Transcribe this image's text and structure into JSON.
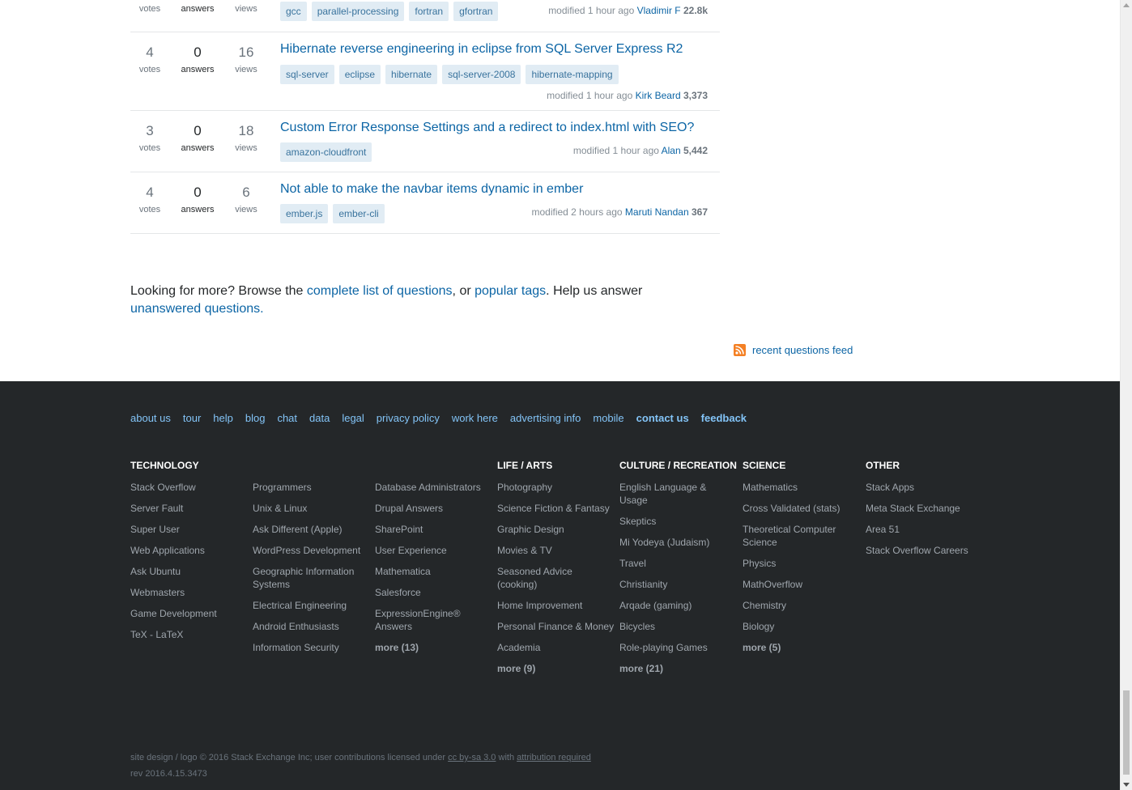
{
  "questions": [
    {
      "votes": "",
      "votes_label": "votes",
      "answers": "",
      "answers_label": "answers",
      "views": "",
      "views_label": "views",
      "title": "",
      "tags": [
        "gcc",
        "parallel-processing",
        "fortran",
        "gfortran"
      ],
      "modified": "modified 1 hour ago",
      "user": "Vladimir F",
      "rep": "22.8k"
    },
    {
      "votes": "4",
      "votes_label": "votes",
      "answers": "0",
      "answers_label": "answers",
      "views": "16",
      "views_label": "views",
      "title": "Hibernate reverse engineering in eclipse from SQL Server Express R2",
      "tags": [
        "sql-server",
        "eclipse",
        "hibernate",
        "sql-server-2008",
        "hibernate-mapping"
      ],
      "modified": "modified 1 hour ago",
      "user": "Kirk Beard",
      "rep": "3,373"
    },
    {
      "votes": "3",
      "votes_label": "votes",
      "answers": "0",
      "answers_label": "answers",
      "views": "18",
      "views_label": "views",
      "title": "Custom Error Response Settings and a redirect to index.html with SEO?",
      "tags": [
        "amazon-cloudfront"
      ],
      "modified": "modified 1 hour ago",
      "user": "Alan",
      "rep": "5,442"
    },
    {
      "votes": "4",
      "votes_label": "votes",
      "answers": "0",
      "answers_label": "answers",
      "views": "6",
      "views_label": "views",
      "title": "Not able to make the navbar items dynamic in ember",
      "tags": [
        "ember.js",
        "ember-cli"
      ],
      "modified": "modified 2 hours ago",
      "user": "Maruti Nandan",
      "rep": "367"
    }
  ],
  "looking_for_more": {
    "prefix": "Looking for more? Browse the ",
    "link1": "complete list of questions",
    "mid": ", or ",
    "link2": "popular tags",
    "suffix": ". Help us answer ",
    "link3": "unanswered questions",
    "end": "."
  },
  "feed": {
    "label": "recent questions feed",
    "icon": "rss-icon"
  },
  "footer": {
    "nav": [
      "about us",
      "tour",
      "help",
      "blog",
      "chat",
      "data",
      "legal",
      "privacy policy",
      "work here",
      "advertising info",
      "mobile",
      "contact us",
      "feedback"
    ],
    "columns": [
      {
        "heading": "TECHNOLOGY",
        "items": [
          "Stack Overflow",
          "Server Fault",
          "Super User",
          "Web Applications",
          "Ask Ubuntu",
          "Webmasters",
          "Game Development",
          "TeX - LaTeX"
        ]
      },
      {
        "heading": "",
        "items": [
          "Programmers",
          "Unix & Linux",
          "Ask Different (Apple)",
          "WordPress Development",
          "Geographic Information Systems",
          "Electrical Engineering",
          "Android Enthusiasts",
          "Information Security"
        ]
      },
      {
        "heading": "",
        "items": [
          "Database Administrators",
          "Drupal Answers",
          "SharePoint",
          "User Experience",
          "Mathematica",
          "Salesforce",
          "ExpressionEngine® Answers",
          "more (13)"
        ]
      },
      {
        "heading": "LIFE / ARTS",
        "items": [
          "Photography",
          "Science Fiction & Fantasy",
          "Graphic Design",
          "Movies & TV",
          "Seasoned Advice (cooking)",
          "Home Improvement",
          "Personal Finance & Money",
          "Academia",
          "more (9)"
        ]
      },
      {
        "heading": "CULTURE / RECREATION",
        "items": [
          "English Language & Usage",
          "Skeptics",
          "Mi Yodeya (Judaism)",
          "Travel",
          "Christianity",
          "Arqade (gaming)",
          "Bicycles",
          "Role-playing Games",
          "more (21)"
        ]
      },
      {
        "heading": "SCIENCE",
        "items": [
          "Mathematics",
          "Cross Validated (stats)",
          "Theoretical Computer Science",
          "Physics",
          "MathOverflow",
          "Chemistry",
          "Biology",
          "more (5)"
        ]
      },
      {
        "heading": "OTHER",
        "items": [
          "Stack Apps",
          "Meta Stack Exchange",
          "Area 51",
          "Stack Overflow Careers"
        ]
      }
    ],
    "copyright_prefix": "site design / logo © 2016 Stack Exchange Inc; user contributions licensed under ",
    "license_link": "cc by-sa 3.0",
    "copyright_mid": " with ",
    "attribution_link": "attribution required",
    "rev": "rev 2016.4.15.3473"
  }
}
